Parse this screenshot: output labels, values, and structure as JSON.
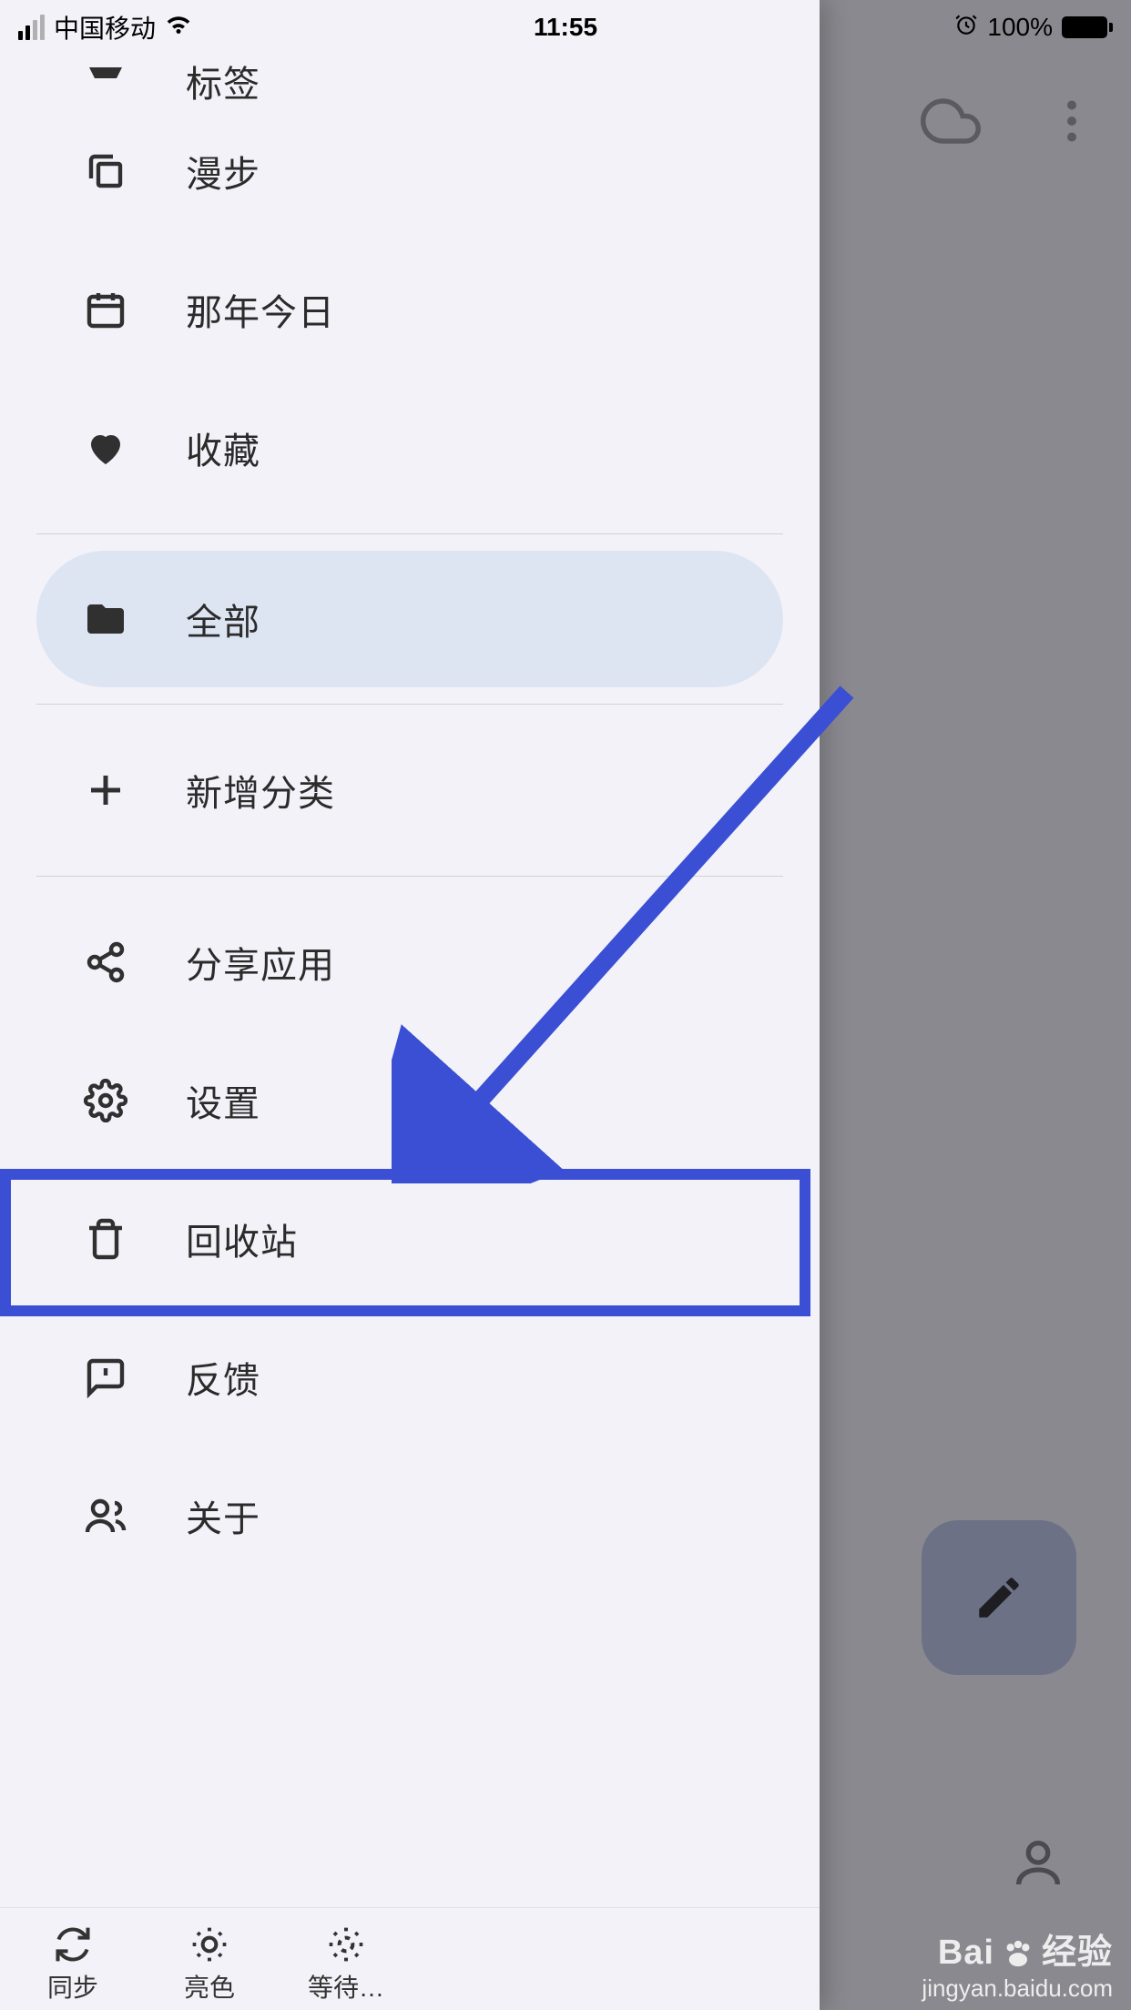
{
  "status_bar": {
    "carrier": "中国移动",
    "time": "11:55",
    "battery_percent": "100%"
  },
  "drawer": {
    "items": {
      "tags": {
        "label": "标签"
      },
      "wander": {
        "label": "漫步"
      },
      "on_this_day": {
        "label": "那年今日"
      },
      "favorites": {
        "label": "收藏"
      },
      "all": {
        "label": "全部"
      },
      "add_category": {
        "label": "新增分类"
      },
      "share_app": {
        "label": "分享应用"
      },
      "settings": {
        "label": "设置"
      },
      "recycle": {
        "label": "回收站"
      },
      "feedback": {
        "label": "反馈"
      },
      "about": {
        "label": "关于"
      }
    },
    "bottom": {
      "sync": "同步",
      "theme": "亮色",
      "wait": "等待…"
    }
  },
  "watermark": {
    "top_left": "Bai",
    "top_right": "经验",
    "url": "jingyan.baidu.com"
  }
}
